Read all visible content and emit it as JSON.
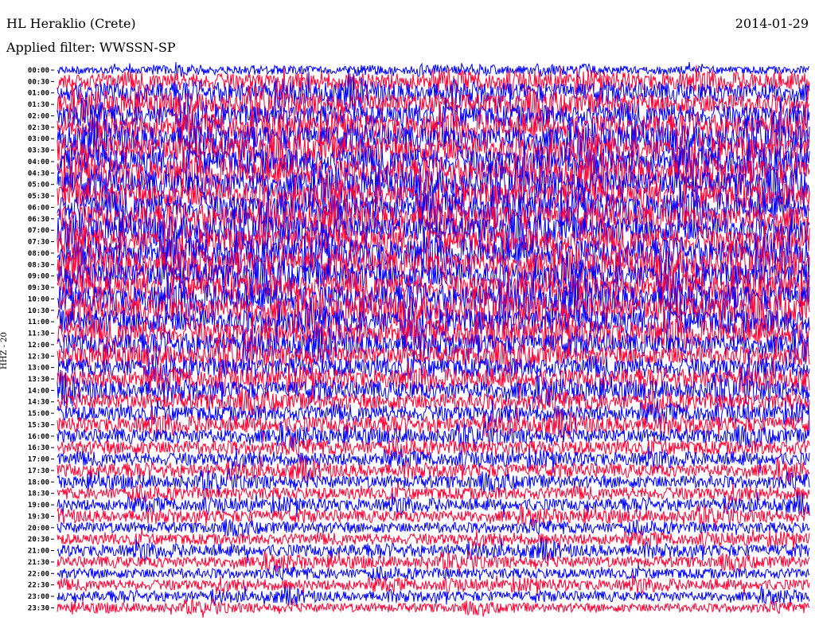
{
  "header": {
    "station": "HL Heraklio (Crete)",
    "date": "2014-01-29",
    "filter": "Applied filter: WWSSN-SP",
    "channel": "HHZ - 20"
  },
  "colors": {
    "trace_odd": "#0000ff",
    "trace_even": "#ff0033",
    "background": "#ffffff",
    "text": "#000000"
  },
  "chart_data": {
    "type": "line",
    "title": "HL Heraklio (Crete)",
    "date": "2014-01-29",
    "ylabel": "HHZ - 20",
    "categories": [
      "00:00",
      "00:30",
      "01:00",
      "01:30",
      "02:00",
      "02:30",
      "03:00",
      "03:30",
      "04:00",
      "04:30",
      "05:00",
      "05:30",
      "06:00",
      "06:30",
      "07:00",
      "07:30",
      "08:00",
      "08:30",
      "09:00",
      "09:30",
      "10:00",
      "10:30",
      "11:00",
      "11:30",
      "12:00",
      "12:30",
      "13:00",
      "13:30",
      "14:00",
      "14:30",
      "15:00",
      "15:30",
      "16:00",
      "16:30",
      "17:00",
      "17:30",
      "18:00",
      "18:30",
      "19:00",
      "19:30",
      "20:00",
      "20:30",
      "21:00",
      "21:30",
      "22:00",
      "22:30",
      "23:00",
      "23:30"
    ],
    "series_colors": [
      "#0000ff",
      "#ff0033"
    ],
    "row_amplitude": [
      0.6,
      1.3,
      1.5,
      1.6,
      1.7,
      1.8,
      1.9,
      2.0,
      2.0,
      2.0,
      2.0,
      2.0,
      2.0,
      2.0,
      2.0,
      2.0,
      2.0,
      2.0,
      2.0,
      2.0,
      2.0,
      2.0,
      1.9,
      1.8,
      1.6,
      1.5,
      1.5,
      1.4,
      1.4,
      1.3,
      1.2,
      1.2,
      1.1,
      1.1,
      1.0,
      1.0,
      1.0,
      0.95,
      0.9,
      0.9,
      0.85,
      0.85,
      0.9,
      0.85,
      0.8,
      0.8,
      0.75,
      0.7
    ]
  }
}
